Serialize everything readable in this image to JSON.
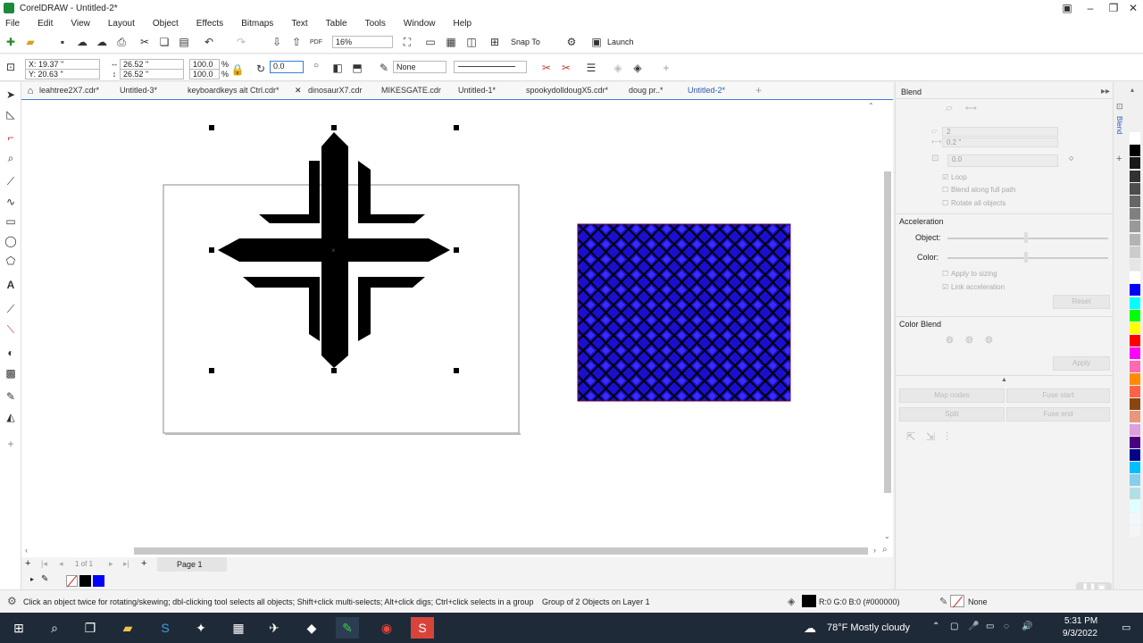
{
  "window": {
    "title": "CorelDRAW - Untitled-2*"
  },
  "menu": [
    "File",
    "Edit",
    "View",
    "Layout",
    "Object",
    "Effects",
    "Bitmaps",
    "Text",
    "Table",
    "Tools",
    "Window",
    "Help"
  ],
  "toolbar": {
    "zoom": "16%",
    "snap_to": "Snap To",
    "launch": "Launch",
    "pdf_label": "PDF"
  },
  "propbar": {
    "x": "X: 19.37 \"",
    "y": "Y: 20.63 \"",
    "width": "26.52 \"",
    "height": "26.52 \"",
    "scale_w": "100.0",
    "scale_h": "100.0",
    "pct": "%",
    "rotation": "0.0",
    "outline": "None"
  },
  "doc_tabs": [
    "leahtree2X7.cdr*",
    "Untitled-3*",
    "keyboardkeys alt Ctrl.cdr*",
    "dinosaurX7.cdr",
    "MIKESGATE.cdr",
    "Untitled-1*",
    "spookydolldougX5.cdr*",
    "doug pr..*",
    "Untitled-2*"
  ],
  "page_nav": {
    "counter": "1 of 1",
    "page_tab": "Page 1"
  },
  "docker": {
    "title": "Blend",
    "steps": "2",
    "spacing": "0.2 \"",
    "rotation": "0.0",
    "loop": "Loop",
    "blend_full_path": "Blend along full path",
    "rotate_all": "Rotate all objects",
    "acceleration": "Acceleration",
    "object": "Object:",
    "color": "Color:",
    "apply_sizing": "Apply to sizing",
    "link_accel": "Link acceleration",
    "reset": "Reset",
    "color_blend": "Color Blend",
    "apply": "Apply",
    "map_nodes": "Map nodes",
    "fuse_start": "Fuse start",
    "split": "Split",
    "fuse_end": "Fuse end",
    "vertical_tab": "Blend"
  },
  "status": {
    "hint": "Click an object twice for rotating/skewing; dbl-clicking tool selects all objects; Shift+click multi-selects; Alt+click digs; Ctrl+click selects in a group",
    "selection": "Group of 2 Objects on Layer 1",
    "fill": "R:0 G:0 B:0 (#000000)",
    "outline": "None"
  },
  "taskbar": {
    "weather": "78°F  Mostly cloudy",
    "time": "5:31 PM",
    "date": "9/3/2022"
  },
  "palette_colors": [
    "#ffffff",
    "#000000",
    "#1a1a1a",
    "#333333",
    "#4d4d4d",
    "#666666",
    "#808080",
    "#999999",
    "#b3b3b3",
    "#cccccc",
    "#e6e6e6",
    "#ffffff",
    "#0000ff",
    "#00ffff",
    "#00ff00",
    "#ffff00",
    "#ff0000",
    "#ff00ff",
    "#ff69b4",
    "#ff8c00",
    "#ff6347",
    "#8b4513",
    "#e9967a",
    "#dda0dd",
    "#4b0082",
    "#00008b",
    "#00bfff",
    "#87ceeb",
    "#b0e0e6",
    "#e0ffff",
    "#f0f8ff",
    "#f5f5f5"
  ]
}
